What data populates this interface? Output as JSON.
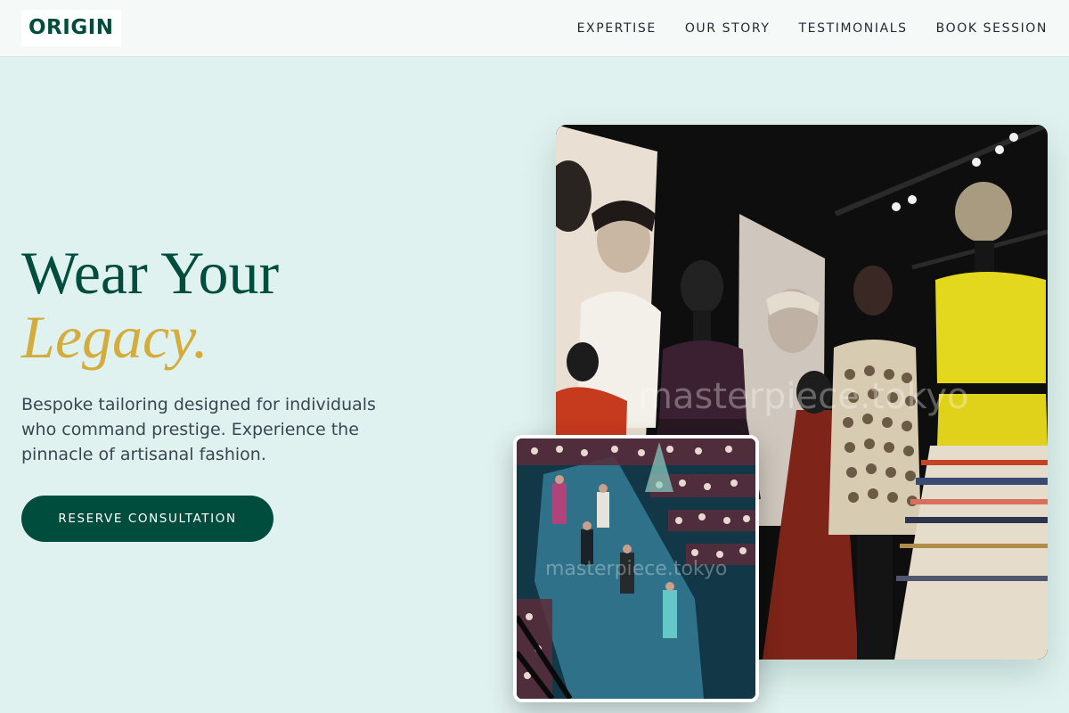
{
  "brand": {
    "logo": "ORIGIN"
  },
  "nav": {
    "links": [
      "EXPERTISE",
      "OUR STORY",
      "TESTIMONIALS",
      "BOOK SESSION"
    ]
  },
  "hero": {
    "title_line1": "Wear Your",
    "title_line2": "Legacy.",
    "subtitle": "Bespoke tailoring designed for individuals who command prestige. Experience the pinnacle of artisanal fashion.",
    "cta_label": "RESERVE CONSULTATION"
  },
  "images": {
    "main_watermark": "masterpiece.tokyo",
    "inset_watermark": "masterpiece.tokyo"
  },
  "colors": {
    "brand_green": "#004d3d",
    "accent_gold": "#d4ac3c",
    "background": "#e0f2ef"
  }
}
